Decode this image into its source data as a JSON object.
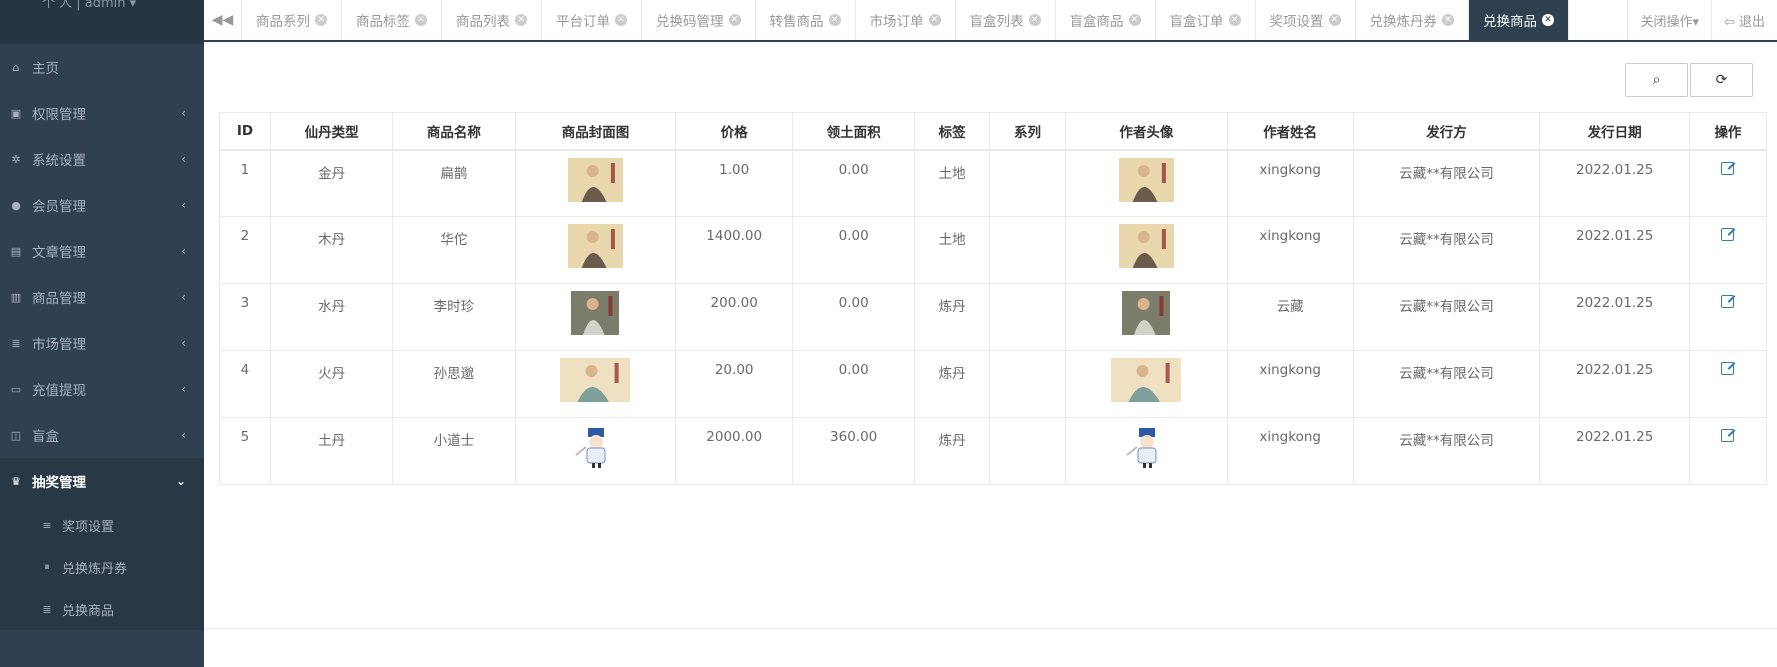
{
  "sidebar": {
    "user_text": "个   人  |  admin ▾",
    "items": [
      {
        "label": "主页",
        "icon": "home-icon",
        "glyph": "⌂",
        "chevron": false
      },
      {
        "label": "权限管理",
        "icon": "lock-icon",
        "glyph": "▣",
        "chevron": true
      },
      {
        "label": "系统设置",
        "icon": "gear-icon",
        "glyph": "✲",
        "chevron": true
      },
      {
        "label": "会员管理",
        "icon": "user-icon",
        "glyph": "●",
        "chevron": true
      },
      {
        "label": "文章管理",
        "icon": "book-icon",
        "glyph": "▤",
        "chevron": true
      },
      {
        "label": "商品管理",
        "icon": "barcode-icon",
        "glyph": "▥",
        "chevron": true
      },
      {
        "label": "市场管理",
        "icon": "list-icon",
        "glyph": "≣",
        "chevron": true
      },
      {
        "label": "充值提现",
        "icon": "credit-card-icon",
        "glyph": "▭",
        "chevron": true
      },
      {
        "label": "盲盒",
        "icon": "hdd-icon",
        "glyph": "◫",
        "chevron": true
      }
    ],
    "active_item": {
      "label": "抽奖管理",
      "icon": "trophy-icon",
      "glyph": "♛"
    },
    "sub_items": [
      {
        "label": "奖项设置",
        "icon": "list-icon",
        "glyph": "≡"
      },
      {
        "label": "兑换炼丹券",
        "icon": "columns-icon",
        "glyph": "⏸"
      },
      {
        "label": "兑换商品",
        "icon": "list-icon",
        "glyph": "≣"
      }
    ]
  },
  "topbar": {
    "back_glyph": "◀◀",
    "tabs": [
      {
        "label": "商品系列",
        "active": false
      },
      {
        "label": "商品标签",
        "active": false
      },
      {
        "label": "商品列表",
        "active": false
      },
      {
        "label": "平台订单",
        "active": false
      },
      {
        "label": "兑换码管理",
        "active": false
      },
      {
        "label": "转售商品",
        "active": false
      },
      {
        "label": "市场订单",
        "active": false
      },
      {
        "label": "盲盒列表",
        "active": false
      },
      {
        "label": "盲盒商品",
        "active": false
      },
      {
        "label": "盲盒订单",
        "active": false
      },
      {
        "label": "奖项设置",
        "active": false
      },
      {
        "label": "兑换炼丹券",
        "active": false
      },
      {
        "label": "兑换商品",
        "active": true
      }
    ],
    "close_ops_label": "关闭操作▾",
    "logout_label": "⇦ 退出"
  },
  "toolbar": {
    "search_glyph": "⌕",
    "refresh_glyph": "⟳"
  },
  "table": {
    "headers": [
      "ID",
      "仙丹类型",
      "商品名称",
      "商品封面图",
      "价格",
      "领土面积",
      "标签",
      "系列",
      "作者头像",
      "作者姓名",
      "发行方",
      "发行日期",
      "操作"
    ],
    "rows": [
      {
        "id": "1",
        "type": "金丹",
        "name": "扁鹊",
        "price": "1.00",
        "area": "0.00",
        "tag": "土地",
        "series": "",
        "author": "xingkong",
        "issuer": "云藏**有限公司",
        "date": "2022.01.25",
        "img": "painting-bianque"
      },
      {
        "id": "2",
        "type": "木丹",
        "name": "华佗",
        "price": "1400.00",
        "area": "0.00",
        "tag": "土地",
        "series": "",
        "author": "xingkong",
        "issuer": "云藏**有限公司",
        "date": "2022.01.25",
        "img": "painting-huatuo"
      },
      {
        "id": "3",
        "type": "水丹",
        "name": "李时珍",
        "price": "200.00",
        "area": "0.00",
        "tag": "炼丹",
        "series": "",
        "author": "云藏",
        "issuer": "云藏**有限公司",
        "date": "2022.01.25",
        "img": "painting-lishizhen"
      },
      {
        "id": "4",
        "type": "火丹",
        "name": "孙思邈",
        "price": "20.00",
        "area": "0.00",
        "tag": "炼丹",
        "series": "",
        "author": "xingkong",
        "issuer": "云藏**有限公司",
        "date": "2022.01.25",
        "img": "painting-sunsimiao"
      },
      {
        "id": "5",
        "type": "土丹",
        "name": "小道士",
        "price": "2000.00",
        "area": "360.00",
        "tag": "炼丹",
        "series": "",
        "author": "xingkong",
        "issuer": "云藏**有限公司",
        "date": "2022.01.25",
        "img": "cartoon-taoist"
      }
    ]
  }
}
